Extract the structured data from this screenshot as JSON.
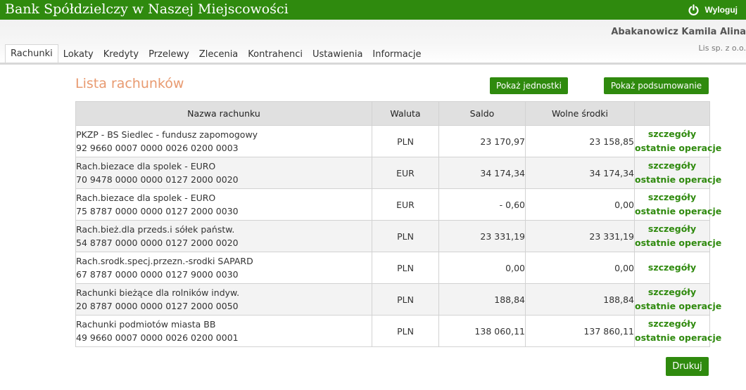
{
  "app": {
    "bank_name": "Bank Spółdzielczy w Naszej Miejscowości",
    "logout_label": "Wyloguj"
  },
  "user": {
    "name": "Abakanowicz Kamila Alina",
    "company": "Lis sp. z o.o."
  },
  "nav": {
    "tabs": [
      {
        "label": "Rachunki",
        "active": true
      },
      {
        "label": "Lokaty"
      },
      {
        "label": "Kredyty"
      },
      {
        "label": "Przelewy"
      },
      {
        "label": "Zlecenia"
      },
      {
        "label": "Kontrahenci"
      },
      {
        "label": "Ustawienia"
      },
      {
        "label": "Informacje"
      }
    ]
  },
  "main": {
    "title": "Lista rachunków",
    "show_units_label": "Pokaż jednostki",
    "show_summary_label": "Pokaż podsumowanie",
    "print_label": "Drukuj",
    "table": {
      "headers": {
        "name": "Nazwa rachunku",
        "currency": "Waluta",
        "balance": "Saldo",
        "available": "Wolne środki"
      },
      "rows": [
        {
          "label": "PKZP - BS Siedlec - fundusz zapomogowy",
          "number": "92 9660 0007 0000 0026 0200 0003",
          "currency": "PLN",
          "balance": "23 170,97",
          "available": "23 158,85",
          "details": "szczegóły",
          "operations": "ostatnie operacje"
        },
        {
          "label": "Rach.biezace dla spolek - EURO",
          "number": "70 9478 0000 0000 0127 2000 0020",
          "currency": "EUR",
          "balance": "34 174,34",
          "available": "34 174,34",
          "details": "szczegóły",
          "operations": "ostatnie operacje"
        },
        {
          "label": "Rach.biezace dla spolek - EURO",
          "number": "75 8787 0000 0000 0127 2000 0030",
          "currency": "EUR",
          "balance": "- 0,60",
          "available": "0,00",
          "details": "szczegóły",
          "operations": "ostatnie operacje"
        },
        {
          "label": "Rach.bież.dla przeds.i sółek państw.",
          "number": "54 8787 0000 0000 0127 2000 0020",
          "currency": "PLN",
          "balance": "23 331,19",
          "available": "23 331,19",
          "details": "szczegóły",
          "operations": "ostatnie operacje"
        },
        {
          "label": "Rach.srodk.specj.przezn.-srodki SAPARD",
          "number": "67 8787 0000 0000 0127 9000 0030",
          "currency": "PLN",
          "balance": "0,00",
          "available": "0,00",
          "details": "szczegóły"
        },
        {
          "label": "Rachunki bieżące dla rolników indyw.",
          "number": "20 8787 0000 0000 0127 2000 0050",
          "currency": "PLN",
          "balance": "188,84",
          "available": "188,84",
          "details": "szczegóły",
          "operations": "ostatnie operacje"
        },
        {
          "label": "Rachunki podmiotów miasta BB",
          "number": "49 9660 0007 0000 0026 0200 0001",
          "currency": "PLN",
          "balance": "138 060,11",
          "available": "137 860,11",
          "details": "szczegóły",
          "operations": "ostatnie operacje"
        }
      ]
    }
  },
  "colors": {
    "brand_green": "#2f8a0e",
    "title_orange": "#e89a70",
    "header_gray": "#e0e0e0"
  },
  "icons": {
    "logout": "power-icon"
  }
}
